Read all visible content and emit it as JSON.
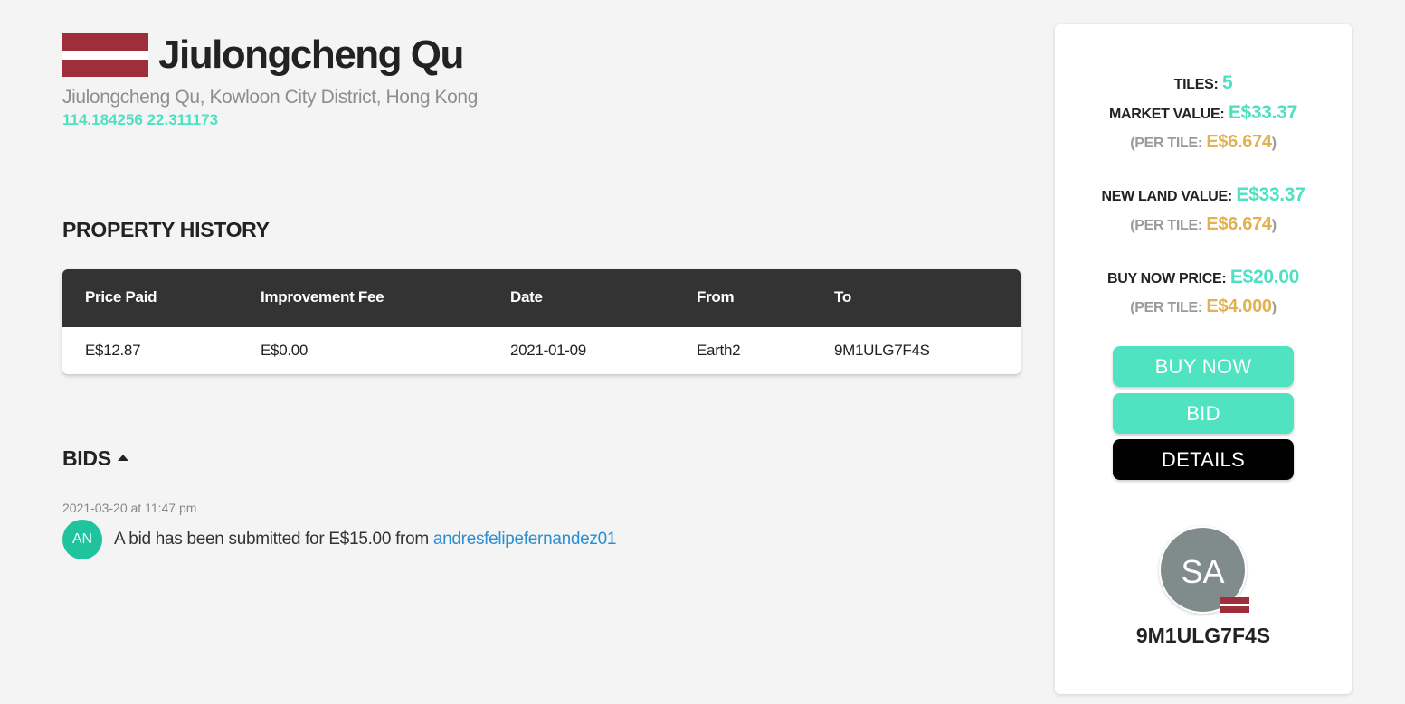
{
  "header": {
    "title": "Jiulongcheng Qu",
    "address": "Jiulongcheng Qu, Kowloon City District, Hong Kong",
    "coordinates": "114.184256 22.311173",
    "flag_icon": "latvia-flag-icon"
  },
  "history": {
    "title": "PROPERTY HISTORY",
    "columns": [
      "Price Paid",
      "Improvement Fee",
      "Date",
      "From",
      "To"
    ],
    "rows": [
      [
        "E$12.87",
        "E$0.00",
        "2021-01-09",
        "Earth2",
        "9M1ULG7F4S"
      ]
    ]
  },
  "bids": {
    "title": "BIDS",
    "items": [
      {
        "date": "2021-03-20 at 11:47 pm",
        "avatar_initials": "AN",
        "text_prefix": "A bid has been submitted for",
        "amount": "E$15.00",
        "text_from": "from",
        "user": "andresfelipefernandez01"
      }
    ]
  },
  "card": {
    "tiles_label": "TILES:",
    "tiles_value": "5",
    "market_label": "MARKET VALUE:",
    "market_value": "E$33.37",
    "market_per_label": "(PER TILE:",
    "market_per_value": "E$6.674",
    "new_land_label": "NEW LAND VALUE:",
    "new_land_value": "E$33.37",
    "new_land_per_label": "(PER TILE:",
    "new_land_per_value": "E$6.674",
    "buy_price_label": "BUY NOW PRICE:",
    "buy_price_value": "E$20.00",
    "buy_per_label": "(PER TILE:",
    "buy_per_value": "E$4.000",
    "close_paren": ")",
    "buy_button": "BUY NOW",
    "bid_button": "BID",
    "details_button": "DETAILS",
    "owner_initials": "SA",
    "owner_name": "9M1ULG7F4S"
  },
  "colors": {
    "accent": "#50e3c2",
    "gold": "#e2b150",
    "table_header": "#333333",
    "link": "#2a8fd0"
  }
}
